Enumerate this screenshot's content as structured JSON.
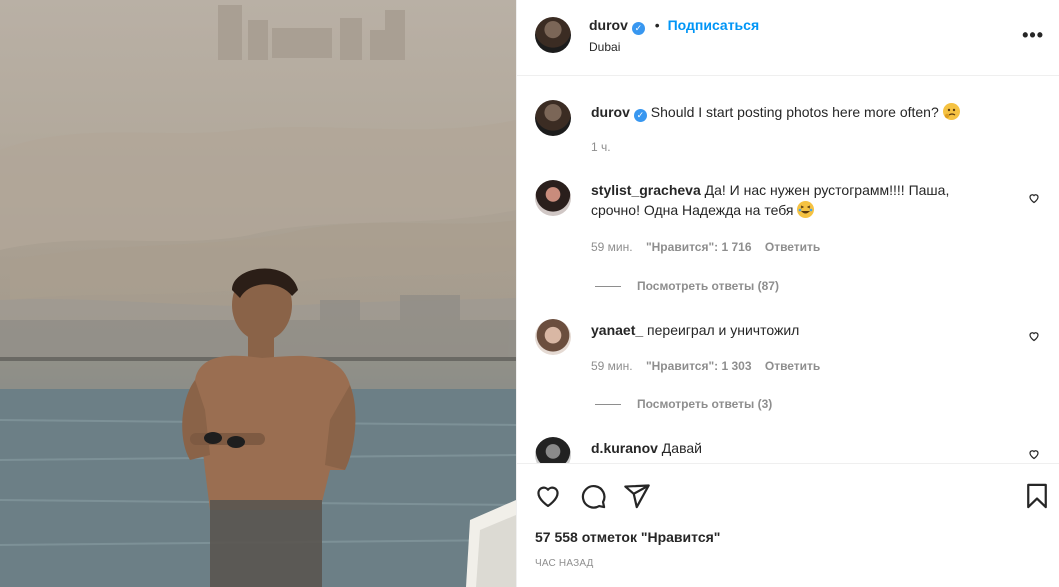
{
  "post": {
    "author": "durov",
    "follow_label": "Подписаться",
    "location": "Dubai",
    "more_label": "•••",
    "caption": "Should I start posting photos here more often?",
    "caption_time": "1 ч."
  },
  "comments": [
    {
      "user": "stylist_gracheva",
      "text": "Да! И нас нужен рустограмм!!!! Паша,",
      "text2": "срочно! Одна Надежда на тебя",
      "time": "59 мин.",
      "likes": "\"Нравится\": 1 716",
      "reply": "Ответить",
      "view_replies": "Посмотреть ответы (87)"
    },
    {
      "user": "yanaet_",
      "text": "переиграл и уничтожил",
      "time": "59 мин.",
      "likes": "\"Нравится\": 1 303",
      "reply": "Ответить",
      "view_replies": "Посмотреть ответы (3)"
    },
    {
      "user": "d.kuranov",
      "text": "Давай"
    }
  ],
  "footer": {
    "likes_count": "57 558 отметок \"Нравится\"",
    "time_ago": "ЧАС НАЗАД"
  },
  "colors": {
    "accent": "#0095f6",
    "verified": "#3897f0",
    "muted": "#8e8e8e",
    "text": "#262626"
  },
  "icons": [
    "more-options-icon",
    "verified-icon",
    "heart-icon",
    "comment-icon",
    "share-icon",
    "save-icon",
    "emoji-thinking",
    "emoji-laughing"
  ]
}
